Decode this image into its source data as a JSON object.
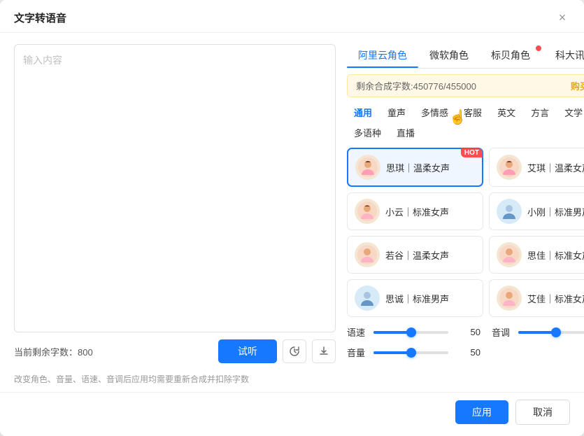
{
  "dialog": {
    "title": "文字转语音",
    "close_label": "×"
  },
  "left": {
    "textarea_placeholder": "输入内容",
    "remaining_label": "当前剩余字数：",
    "remaining_count": "800",
    "btn_preview": "试听",
    "btn_history_icon": "history",
    "btn_download_icon": "download"
  },
  "right": {
    "provider_tabs": [
      {
        "id": "aliyun",
        "label": "阿里云角色",
        "active": true,
        "badge": false
      },
      {
        "id": "microsoft",
        "label": "微软角色",
        "active": false,
        "badge": false
      },
      {
        "id": "biaobei",
        "label": "标贝角色",
        "active": false,
        "badge": true
      },
      {
        "id": "xunfei",
        "label": "科大讯飞角色",
        "active": false,
        "badge": false
      }
    ],
    "quota": {
      "label": "剩余合成字数:450776/455000",
      "link": "购买增值包"
    },
    "category_tabs": [
      {
        "id": "general",
        "label": "通用",
        "active": true
      },
      {
        "id": "child",
        "label": "童声",
        "active": false
      },
      {
        "id": "emotion",
        "label": "多情感",
        "active": false
      },
      {
        "id": "service",
        "label": "客服",
        "active": false
      },
      {
        "id": "english",
        "label": "英文",
        "active": false
      },
      {
        "id": "dialect",
        "label": "方言",
        "active": false
      },
      {
        "id": "literature",
        "label": "文学",
        "active": false
      },
      {
        "id": "multilang",
        "label": "多语种",
        "active": false
      },
      {
        "id": "live",
        "label": "直播",
        "active": false
      }
    ],
    "voices": [
      {
        "id": "siqin",
        "name": "思琪｜温柔女声",
        "avatar": "👩",
        "hot": true,
        "selected": true,
        "avatar_bg": "warm"
      },
      {
        "id": "aiyun",
        "name": "艾琪｜温柔女声",
        "avatar": "👩",
        "hot": true,
        "selected": false,
        "avatar_bg": "warm"
      },
      {
        "id": "xiaoyun",
        "name": "小云｜标准女声",
        "avatar": "👩",
        "hot": false,
        "selected": false,
        "avatar_bg": "warm"
      },
      {
        "id": "xiaogang",
        "name": "小刚｜标准男声",
        "avatar": "🧑",
        "hot": false,
        "selected": false,
        "avatar_bg": "blue"
      },
      {
        "id": "ruogu",
        "name": "若谷｜温柔女声",
        "avatar": "👩",
        "hot": false,
        "selected": false,
        "avatar_bg": "warm"
      },
      {
        "id": "sijia",
        "name": "思佳｜标准女声",
        "avatar": "👩",
        "hot": false,
        "selected": false,
        "avatar_bg": "warm"
      },
      {
        "id": "sicheng",
        "name": "思诚｜标准男声",
        "avatar": "🧑",
        "hot": false,
        "selected": false,
        "avatar_bg": "blue"
      },
      {
        "id": "aijia",
        "name": "艾佳｜标准女声",
        "avatar": "👩",
        "hot": false,
        "selected": false,
        "avatar_bg": "warm"
      }
    ],
    "sliders": [
      {
        "id": "speed",
        "label": "语速",
        "value": 50.0,
        "fill_pct": 50
      },
      {
        "id": "pitch",
        "label": "音调",
        "value": 50.0,
        "fill_pct": 50
      },
      {
        "id": "volume",
        "label": "音量",
        "value": 50.0,
        "fill_pct": 50
      }
    ]
  },
  "footer": {
    "note": "改变角色、音量、语速、音调后应用均需要重新合成并扣除字数",
    "btn_apply": "应用",
    "btn_cancel": "取消"
  }
}
